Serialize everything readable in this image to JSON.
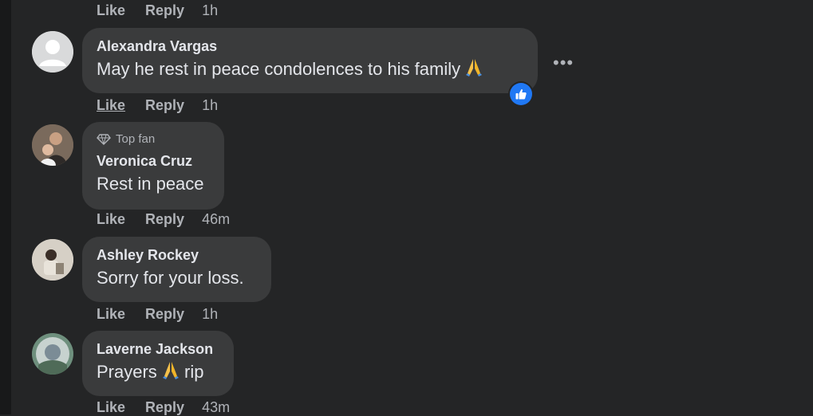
{
  "actions_labels": {
    "like": "Like",
    "reply": "Reply"
  },
  "top_action_row": {
    "time": "1h"
  },
  "comments": [
    {
      "name": "Alexandra Vargas",
      "text": "May he rest in peace condolences to his family",
      "emoji": "pray-emoji",
      "time": "1h",
      "reaction": "like-reaction"
    },
    {
      "badge": "Top fan",
      "name": "Veronica Cruz",
      "text": "Rest in peace",
      "time": "46m"
    },
    {
      "name": "Ashley Rockey",
      "text": "Sorry for your loss.",
      "time": "1h"
    },
    {
      "name": "Laverne Jackson",
      "text_before": "Prayers",
      "text_after": "rip",
      "time": "43m"
    }
  ],
  "colors": {
    "background": "#242526",
    "bubble": "#3a3b3c",
    "text_primary": "#e4e6eb",
    "text_secondary": "#b0b3b8",
    "like_blue": "#2078f4"
  }
}
